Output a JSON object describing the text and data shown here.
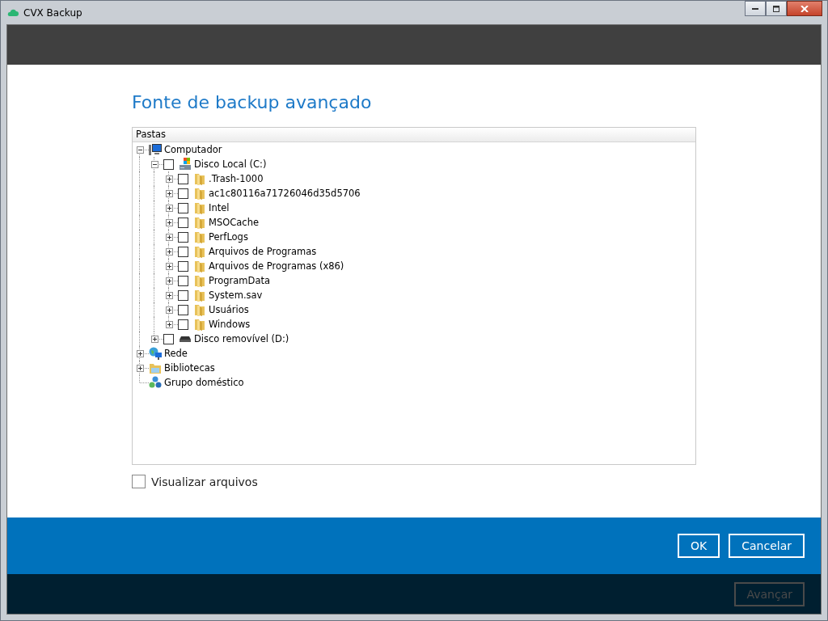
{
  "window": {
    "title": "CVX Backup"
  },
  "heading": "Fonte de backup avançado",
  "tree": {
    "column": "Pastas",
    "items": [
      {
        "label": "Computador",
        "kind": "computer",
        "expanded": true,
        "children": [
          {
            "label": "Disco Local (C:)",
            "kind": "drive",
            "expanded": true,
            "checked": false,
            "children": [
              {
                "label": ".Trash-1000",
                "kind": "folder",
                "expanded": false,
                "checked": false
              },
              {
                "label": "ac1c80116a71726046d35d5706",
                "kind": "folder",
                "expanded": false,
                "checked": false
              },
              {
                "label": "Intel",
                "kind": "folder",
                "expanded": false,
                "checked": false
              },
              {
                "label": "MSOCache",
                "kind": "folder",
                "expanded": false,
                "checked": false
              },
              {
                "label": "PerfLogs",
                "kind": "folder",
                "expanded": false,
                "checked": false
              },
              {
                "label": "Arquivos de Programas",
                "kind": "folder",
                "expanded": false,
                "checked": false
              },
              {
                "label": "Arquivos de Programas (x86)",
                "kind": "folder",
                "expanded": false,
                "checked": false
              },
              {
                "label": "ProgramData",
                "kind": "folder",
                "expanded": false,
                "checked": false
              },
              {
                "label": "System.sav",
                "kind": "folder",
                "expanded": false,
                "checked": false
              },
              {
                "label": "Usuários",
                "kind": "folder",
                "expanded": false,
                "checked": false
              },
              {
                "label": "Windows",
                "kind": "folder",
                "expanded": false,
                "checked": false
              }
            ]
          },
          {
            "label": "Disco removível (D:)",
            "kind": "removable",
            "expanded": false,
            "checked": false
          }
        ]
      },
      {
        "label": "Rede",
        "kind": "network",
        "expanded": false
      },
      {
        "label": "Bibliotecas",
        "kind": "library",
        "expanded": false
      },
      {
        "label": "Grupo doméstico",
        "kind": "homegroup"
      }
    ]
  },
  "show_files": {
    "label": "Visualizar arquivos",
    "checked": false
  },
  "buttons": [
    {
      "label": "OK"
    },
    {
      "label": "Cancelar"
    }
  ],
  "next_button": {
    "label": "Avançar",
    "disabled": true
  }
}
